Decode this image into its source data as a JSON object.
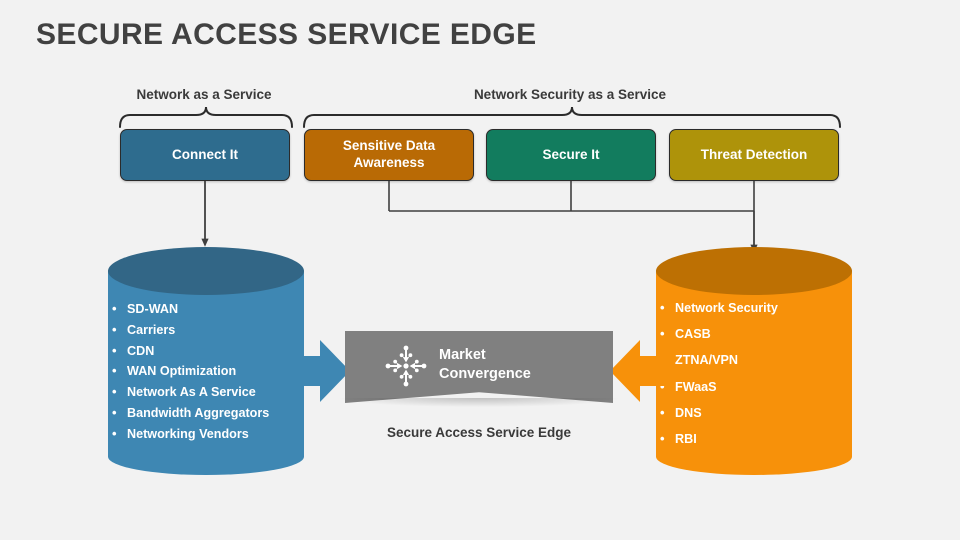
{
  "title": "SECURE ACCESS SERVICE EDGE",
  "groups": [
    {
      "id": "naas",
      "label": "Network as a Service"
    },
    {
      "id": "nsaas",
      "label": "Network Security as a Service"
    }
  ],
  "boxes": [
    {
      "id": "connect",
      "label": "Connect It",
      "color": "#2e6c8e"
    },
    {
      "id": "sensitive",
      "label": "Sensitive Data Awareness",
      "color": "#b96a05"
    },
    {
      "id": "secure",
      "label": "Secure It",
      "color": "#127c5e"
    },
    {
      "id": "threat",
      "label": "Threat Detection",
      "color": "#ae930a"
    }
  ],
  "left_cylinder": {
    "body_color": "#3e87b3",
    "top_color": "#326686",
    "items": [
      "SD-WAN",
      "Carriers",
      "CDN",
      "WAN Optimization",
      "Network As A Service",
      "Bandwidth Aggregators",
      "Networking Vendors"
    ]
  },
  "right_cylinder": {
    "body_color": "#f7910a",
    "top_color": "#bd7003",
    "items": [
      "Network Security",
      "CASB",
      "ZTNA/VPN",
      "FWaaS",
      "DNS",
      "RBI"
    ]
  },
  "banner": {
    "icon": "converging-arrows-icon",
    "line1": "Market",
    "line2": "Convergence",
    "color": "#808080",
    "caption": "Secure Access Service Edge"
  },
  "arrows": {
    "left_arrow_color": "#3e87b3",
    "right_arrow_color": "#f7910a",
    "connector_color": "#3f3f3f"
  },
  "background": "#f2f2f2"
}
